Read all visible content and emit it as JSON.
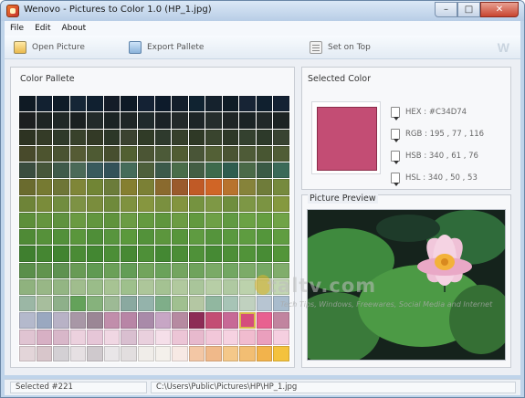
{
  "window": {
    "title": "Wenovo - Pictures to Color 1.0 (HP_1.jpg)",
    "buttons": {
      "minimize": "–",
      "maximize": "□",
      "close": "✕"
    }
  },
  "menu": [
    "File",
    "Edit",
    "About"
  ],
  "toolbar": {
    "open": "Open Picture",
    "export": "Export Pallete",
    "seton": "Set on Top",
    "logo": "W"
  },
  "palette": {
    "title": "Color Pallete",
    "selected_index": 221,
    "swatches": [
      "#0f1a24",
      "#122131",
      "#0f1c28",
      "#152636",
      "#102030",
      "#141c28",
      "#0e1a26",
      "#142234",
      "#0d1b2b",
      "#131e2b",
      "#102331",
      "#15222d",
      "#0f1c26",
      "#172435",
      "#10202f",
      "#142233",
      "#1c1f20",
      "#1e2524",
      "#202827",
      "#1a2021",
      "#222a2a",
      "#1b2324",
      "#1f2626",
      "#202a2c",
      "#1b2226",
      "#23292a",
      "#1d2527",
      "#252d2c",
      "#1f2526",
      "#1b2325",
      "#212829",
      "#1d2424",
      "#2d3322",
      "#343b27",
      "#2f3a2a",
      "#38412b",
      "#333a26",
      "#2c3728",
      "#3b4230",
      "#303b27",
      "#2e3a2d",
      "#363f2b",
      "#2f3926",
      "#39442e",
      "#2e3828",
      "#34412f",
      "#2d3a2a",
      "#384331",
      "#484a2b",
      "#4d542f",
      "#4a5332",
      "#555b34",
      "#4e5a33",
      "#474f2f",
      "#526032",
      "#4b5534",
      "#4c5a38",
      "#515c33",
      "#495537",
      "#536036",
      "#4a5433",
      "#4e5b37",
      "#485632",
      "#505d36",
      "#3a4d3f",
      "#46563a",
      "#3f5a4a",
      "#4b6a58",
      "#395a5d",
      "#335259",
      "#456c5a",
      "#4d5f3b",
      "#3c5a4b",
      "#4a6d49",
      "#435e44",
      "#3e6a4c",
      "#2f5d4f",
      "#4a6a48",
      "#3a5a45",
      "#3b6a58",
      "#6a6b2e",
      "#767a32",
      "#6e7637",
      "#7f8638",
      "#718535",
      "#6b7c3a",
      "#857f30",
      "#7b8035",
      "#8a6a2e",
      "#9a5a2c",
      "#c05a26",
      "#d06526",
      "#b8732e",
      "#86833a",
      "#6f7c3a",
      "#768a3e",
      "#6e8438",
      "#7a8c3a",
      "#718d3f",
      "#7d9244",
      "#7a8d3d",
      "#6f8a3b",
      "#7f923f",
      "#86963f",
      "#7a903f",
      "#83943e",
      "#759340",
      "#7e9845",
      "#6f8e3e",
      "#7d9745",
      "#7b9442",
      "#85993f",
      "#5d8f3a",
      "#65953e",
      "#5f923f",
      "#6a9a42",
      "#62963e",
      "#5f933c",
      "#6b9c44",
      "#649a3f",
      "#5f963d",
      "#6c9c43",
      "#62993f",
      "#6ea046",
      "#619a42",
      "#6ba244",
      "#659e40",
      "#70a347",
      "#4f8a36",
      "#56913a",
      "#52903a",
      "#5a963c",
      "#4f8e38",
      "#58953e",
      "#5b993c",
      "#53923a",
      "#5c963d",
      "#57953b",
      "#5f9b41",
      "#55943c",
      "#5a993f",
      "#5e9c40",
      "#54963b",
      "#609d41",
      "#3f7f2f",
      "#458632",
      "#418431",
      "#4a8b35",
      "#438732",
      "#4c8e37",
      "#478934",
      "#4e9038",
      "#448833",
      "#4b8d36",
      "#4f9139",
      "#468a34",
      "#4d8f37",
      "#519339",
      "#488c35",
      "#539539",
      "#5a8f4a",
      "#62944e",
      "#5e9250",
      "#689b55",
      "#609a52",
      "#6ba058",
      "#639d56",
      "#72a45c",
      "#6aa25a",
      "#74a560",
      "#6fa35c",
      "#7aaa66",
      "#72a762",
      "#7cab68",
      "#75a864",
      "#80ad6b",
      "#8fb27e",
      "#98b786",
      "#93b583",
      "#a0bd8d",
      "#9abc89",
      "#a7c393",
      "#9ec08c",
      "#adc69a",
      "#a4c292",
      "#b1c99e",
      "#a9c59a",
      "#b7cea6",
      "#afc9a1",
      "#bcd2ac",
      "#b5cda6",
      "#c2d6b2",
      "#9bb7a5",
      "#a7be9d",
      "#8eb08a",
      "#64a25a",
      "#86b27c",
      "#9dba95",
      "#8aa9a0",
      "#94b3ab",
      "#7fae89",
      "#a0c090",
      "#b4c7a3",
      "#91b7a0",
      "#a7c4b6",
      "#c0d1bf",
      "#b7c5d2",
      "#a9bccd",
      "#b4b9cc",
      "#9aa8c0",
      "#b8b2c6",
      "#a897a6",
      "#9b8695",
      "#c18eab",
      "#b885a6",
      "#a98aa9",
      "#c7a6c5",
      "#b68aa1",
      "#8d2c56",
      "#c34d74",
      "#c76996",
      "#d54d7c",
      "#e86090",
      "#c1849f",
      "#e0c4d2",
      "#d7b0c4",
      "#d8b7c9",
      "#ecd1de",
      "#e6c6d7",
      "#f0d7e3",
      "#d9bfd0",
      "#e9d0dd",
      "#f5dfe9",
      "#ecc5d6",
      "#e7b9cd",
      "#f2c7d9",
      "#f6d2e1",
      "#f1bccf",
      "#ea9fbd",
      "#f5cfe0",
      "#e3d5d9",
      "#d8c6cb",
      "#d3d0d4",
      "#e6e0e3",
      "#cfc9cd",
      "#e9e6e8",
      "#e2dedf",
      "#f0ede9",
      "#f4f0eb",
      "#f7e9e4",
      "#f3c7a5",
      "#f0b98a",
      "#f4c889",
      "#f2be73",
      "#f2b34c",
      "#f4c23d"
    ]
  },
  "selected_color": {
    "title": "Selected Color",
    "color": "#C34D74",
    "hex": "HEX : #C34D74",
    "rgb": "RGB : 195 , 77 , 116",
    "hsb": "HSB : 340 , 61 , 76",
    "hsl": "HSL : 340 , 50 , 53"
  },
  "preview": {
    "title": "Picture Preview"
  },
  "watermark": {
    "main": "taltv.com",
    "sub": "Tech Tips, Windows, Freewares, Social Media and Internet"
  },
  "status": {
    "selected": "Selected #221",
    "path": "C:\\Users\\Public\\Pictures\\HP\\HP_1.jpg"
  }
}
